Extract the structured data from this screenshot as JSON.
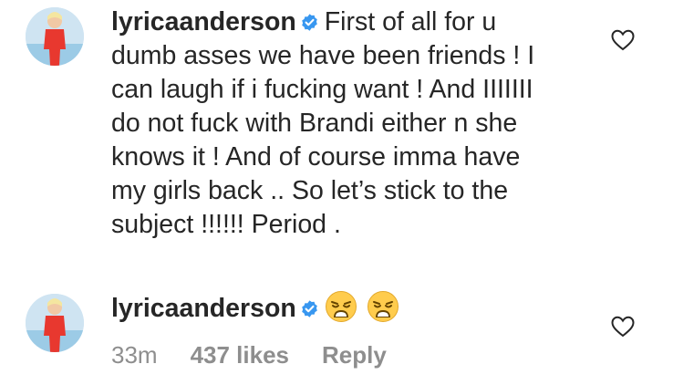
{
  "comments": [
    {
      "username": "lyricaanderson",
      "verified": true,
      "text": "First of all for u dumb asses we have been friends ! I can laugh if i fucking want ! And IIIIIII do not fuck with Brandi either n she knows it ! And of course imma have my girls back .. So let’s stick to the subject !!!!!! Period ."
    },
    {
      "username": "lyricaanderson",
      "verified": true,
      "emojis": [
        "weary-face-emoji",
        "weary-face-emoji"
      ],
      "time": "33m",
      "likes": "437 likes",
      "reply_label": "Reply"
    }
  ],
  "colors": {
    "text": "#262626",
    "muted": "#8e8e8e",
    "verified_blue": "#3897f0",
    "avatar_bg": "#cfe4f2",
    "avatar_outfit": "#e8382f"
  },
  "icons": [
    "verified-badge-icon",
    "heart-icon",
    "weary-face-emoji"
  ]
}
